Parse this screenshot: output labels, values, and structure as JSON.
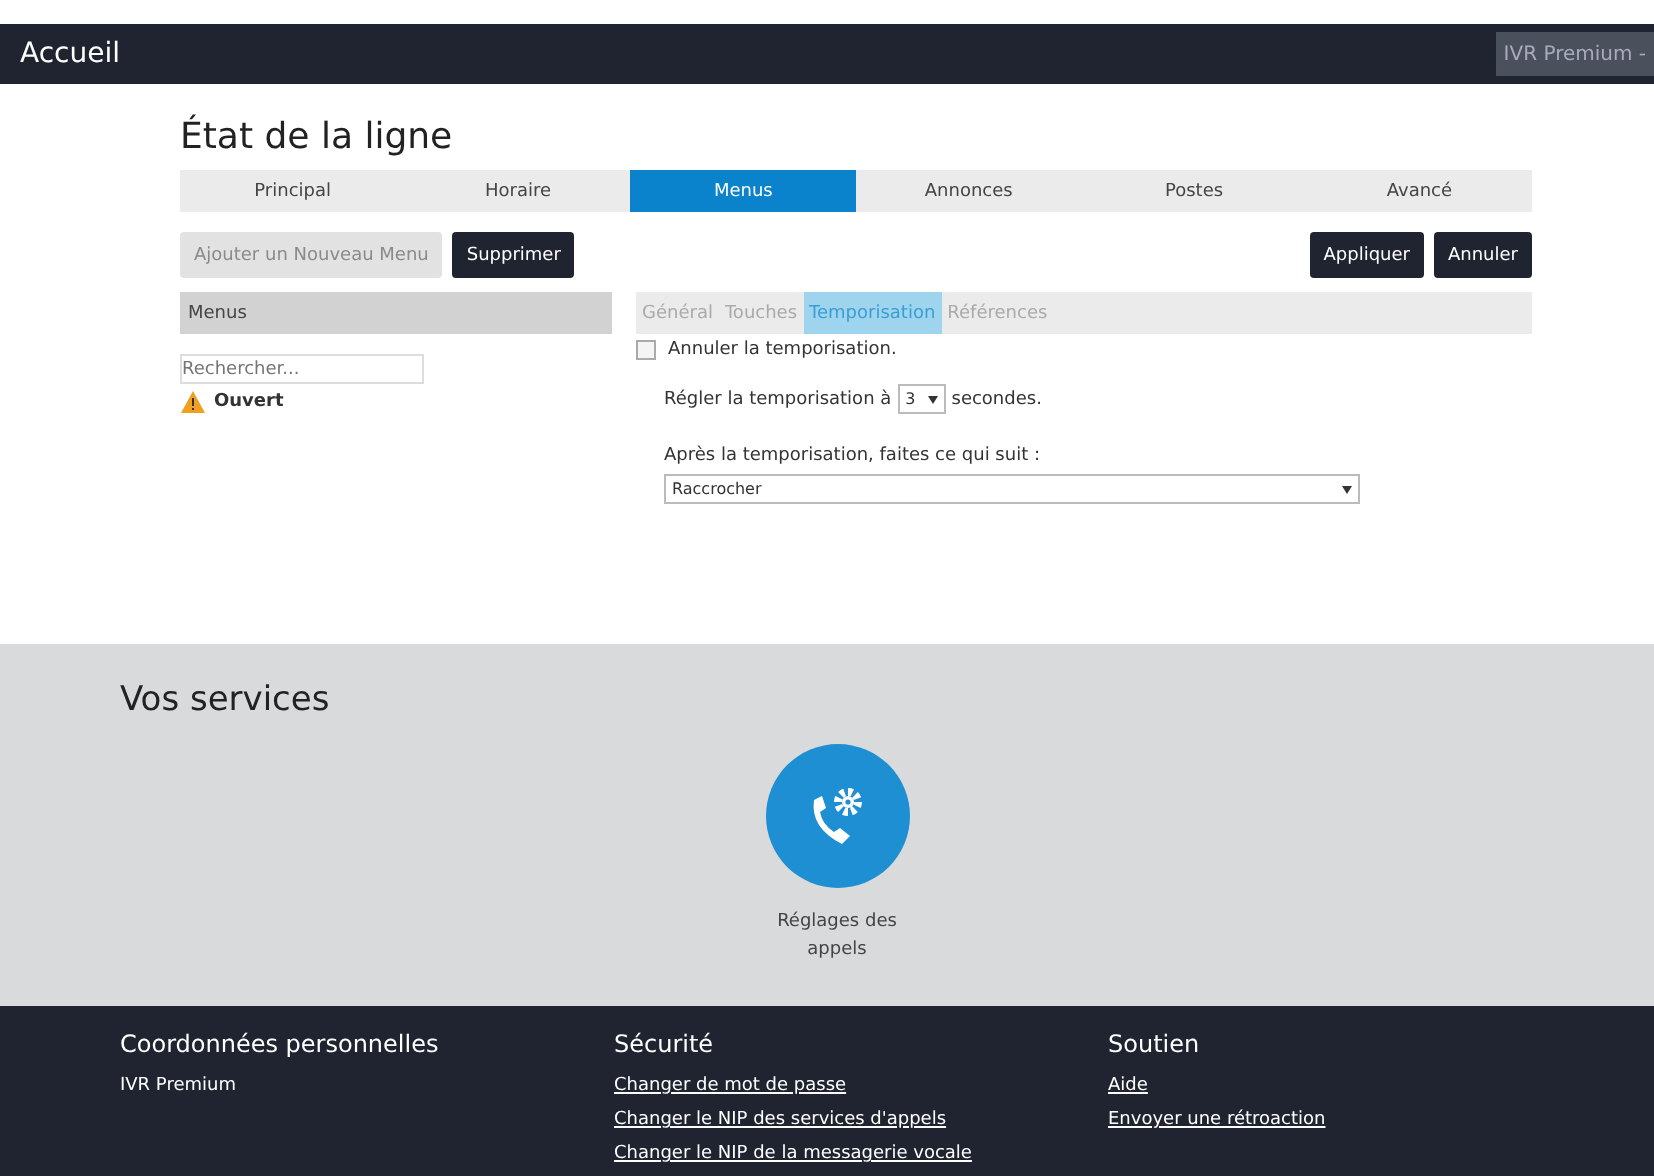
{
  "header": {
    "title": "Accueil",
    "account": "IVR Premium -"
  },
  "page_title": "État de la ligne",
  "tabs": [
    {
      "label": "Principal",
      "selected": false
    },
    {
      "label": "Horaire",
      "selected": false
    },
    {
      "label": "Menus",
      "selected": true
    },
    {
      "label": "Annonces",
      "selected": false
    },
    {
      "label": "Postes",
      "selected": false
    },
    {
      "label": "Avancé",
      "selected": false
    }
  ],
  "actions_left": [
    {
      "label": "Ajouter un Nouveau Menu",
      "disabled": true
    },
    {
      "label": "Supprimer",
      "disabled": false
    }
  ],
  "actions_right": [
    {
      "label": "Appliquer",
      "disabled": false
    },
    {
      "label": "Annuler",
      "disabled": false
    }
  ],
  "menus_panel": {
    "title": "Menus",
    "search_placeholder": "Rechercher...",
    "items": [
      {
        "label": "Ouvert",
        "warning": true
      }
    ]
  },
  "subtabs": [
    {
      "label": "Général",
      "selected": false
    },
    {
      "label": "Touches",
      "selected": false
    },
    {
      "label": "Temporisation",
      "selected": true
    },
    {
      "label": "Références",
      "selected": false
    }
  ],
  "cancel_timeout": {
    "label": "Annuler la temporisation.",
    "checked": false
  },
  "timeout_row": {
    "before": "Régler la temporisation à",
    "value": "3",
    "after": "secondes."
  },
  "after_timeout": {
    "label": "Après la temporisation, faites ce qui suit :",
    "value": "Raccrocher"
  },
  "services": {
    "title": "Vos services",
    "items": [
      {
        "label": "Réglages des appels"
      }
    ]
  },
  "footer": [
    {
      "title": "Coordonnées personnelles",
      "items": [
        {
          "label": "IVR Premium",
          "link": false
        }
      ]
    },
    {
      "title": "Sécurité",
      "items": [
        {
          "label": "Changer de mot de passe",
          "link": true
        },
        {
          "label": "Changer le NIP des services d'appels",
          "link": true
        },
        {
          "label": "Changer le NIP de la messagerie vocale",
          "link": true
        }
      ]
    },
    {
      "title": "Soutien",
      "items": [
        {
          "label": "Aide",
          "link": true
        },
        {
          "label": "Envoyer une rétroaction",
          "link": true
        }
      ]
    }
  ]
}
